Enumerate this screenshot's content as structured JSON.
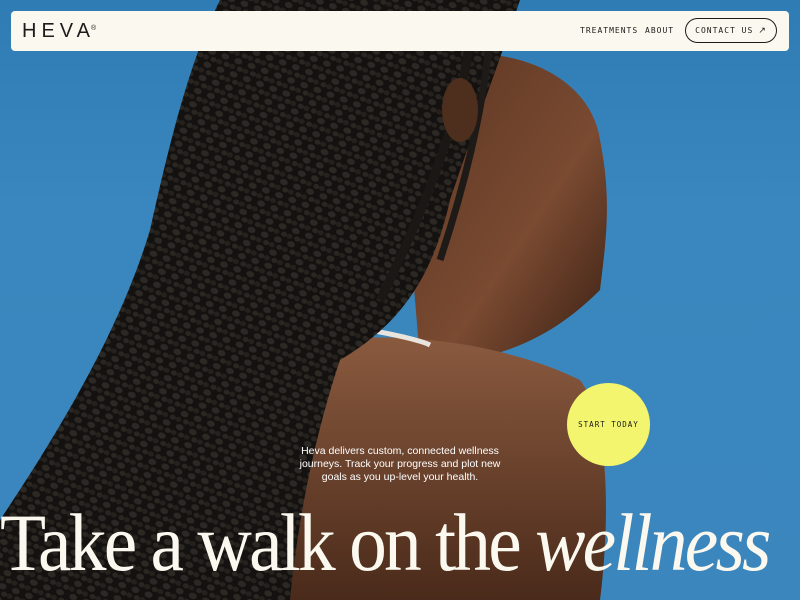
{
  "brand": {
    "logo": "HEVA",
    "logo_mark": "®"
  },
  "nav": {
    "links": [
      "TREATMENTS",
      "ABOUT"
    ],
    "contact_label": "CONTACT US",
    "contact_icon": "arrow-up-right-icon"
  },
  "hero": {
    "cta_label": "START TODAY",
    "blurb": "Heva delivers custom, connected wellness journeys. Track your progress and plot new goals as you up-level your health.",
    "headline_regular": "Take a walk on the",
    "headline_italic": "wellness"
  },
  "colors": {
    "sky": "#3a87bf",
    "navbar_bg": "#fbf8ef",
    "cta_bg": "#f3f56e",
    "text_dark": "#1c1c1c",
    "text_light": "#fbf8ef"
  }
}
